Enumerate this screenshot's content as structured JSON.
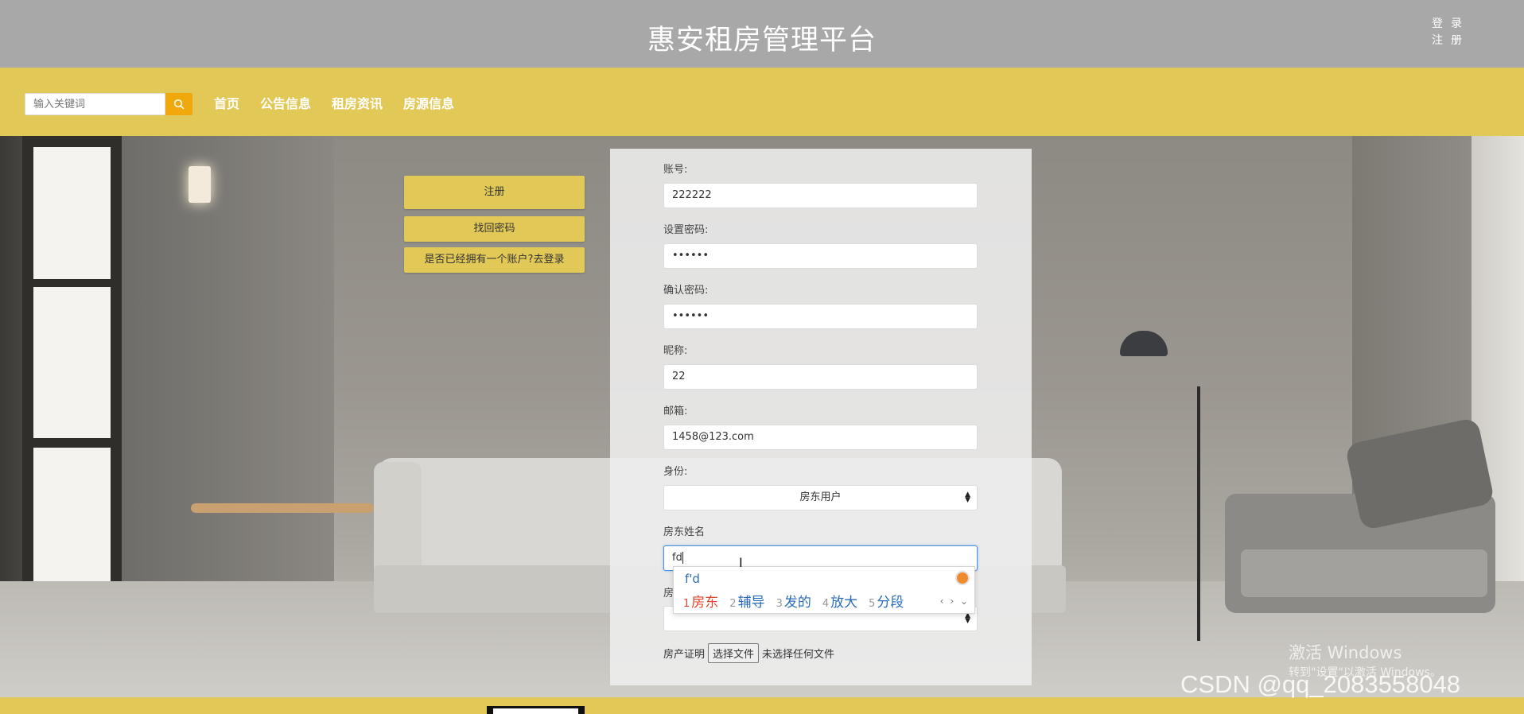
{
  "header": {
    "title": "惠安租房管理平台",
    "login_label": "登录",
    "register_label": "注册"
  },
  "nav": {
    "search_placeholder": "输入关键词",
    "items": [
      "首页",
      "公告信息",
      "租房资讯",
      "房源信息"
    ]
  },
  "side_buttons": {
    "register": "注册",
    "recover": "找回密码",
    "login": "是否已经拥有一个账户?去登录"
  },
  "form": {
    "account_label": "账号:",
    "account_value": "222222",
    "password_label": "设置密码:",
    "password_value": "••••••",
    "confirm_label": "确认密码:",
    "confirm_value": "••••••",
    "nickname_label": "昵称:",
    "nickname_value": "22",
    "email_label": "邮箱:",
    "email_value": "1458@123.com",
    "role_label": "身份:",
    "role_value": "房东用户",
    "landlord_name_label": "房东姓名",
    "landlord_name_value": "fd",
    "hidden_label_fragment": "房",
    "property_cert_label": "房产证明",
    "file_button": "选择文件",
    "file_status": "未选择任何文件"
  },
  "ime": {
    "composition": "f'd",
    "candidates": [
      {
        "n": "1",
        "text": "房东"
      },
      {
        "n": "2",
        "text": "辅导"
      },
      {
        "n": "3",
        "text": "发的"
      },
      {
        "n": "4",
        "text": "放大"
      },
      {
        "n": "5",
        "text": "分段"
      }
    ],
    "nav": "‹ › ⌄"
  },
  "overlay": {
    "activate_title": "激活 Windows",
    "activate_sub": "转到\"设置\"以激活 Windows。",
    "watermark": "CSDN @qq_2083558048"
  },
  "colors": {
    "header_bg": "#a8a8a8",
    "accent_yellow": "#e2c857",
    "search_button": "#f0a80d"
  }
}
